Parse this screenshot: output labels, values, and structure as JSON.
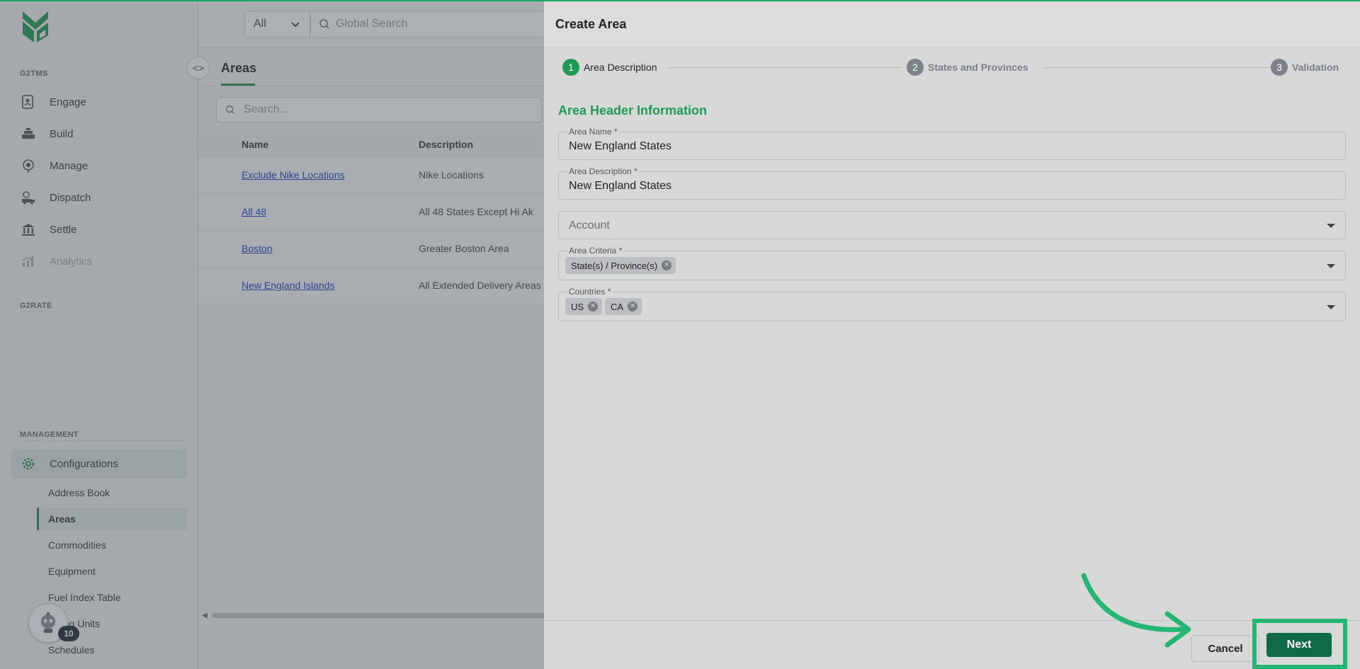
{
  "colors": {
    "brand_green": "#1e9a54",
    "accent_dark_green": "#0f6b45",
    "link_blue": "#1a3fc4",
    "highlight_green": "#26b673"
  },
  "sidebar": {
    "sections": {
      "g2tms": "G2TMS",
      "g2rate": "G2RATE",
      "management": "MANAGEMENT"
    },
    "items": [
      {
        "label": "Engage",
        "icon": "engage-icon"
      },
      {
        "label": "Build",
        "icon": "build-icon"
      },
      {
        "label": "Manage",
        "icon": "manage-icon"
      },
      {
        "label": "Dispatch",
        "icon": "dispatch-icon"
      },
      {
        "label": "Settle",
        "icon": "settle-icon"
      },
      {
        "label": "Analytics",
        "icon": "analytics-icon"
      }
    ],
    "configurations": {
      "label": "Configurations",
      "icon": "gear-icon"
    },
    "sub_items": [
      "Address Book",
      "Areas",
      "Commodities",
      "Equipment",
      "Fuel Index Table",
      "Billing Units",
      "Schedules"
    ],
    "assistant_badge": "10"
  },
  "topbar": {
    "scope": "All",
    "search_placeholder": "Global Search"
  },
  "main": {
    "title": "Areas",
    "search_placeholder": "Search...",
    "columns": [
      "Name",
      "Description"
    ],
    "rows": [
      {
        "name": "Exclude Nike Locations",
        "description": "Nike Locations"
      },
      {
        "name": "All 48",
        "description": "All 48 States Except Hi Ak"
      },
      {
        "name": "Boston",
        "description": "Greater Boston Area"
      },
      {
        "name": "New England Islands",
        "description": "All Extended Delivery Areas"
      }
    ]
  },
  "drawer": {
    "title": "Create Area",
    "steps": [
      {
        "num": "1",
        "label": "Area Description"
      },
      {
        "num": "2",
        "label": "States and Provinces"
      },
      {
        "num": "3",
        "label": "Validation"
      }
    ],
    "section_title": "Area Header Information",
    "fields": {
      "area_name": {
        "label": "Area Name *",
        "value": "New England States"
      },
      "area_description": {
        "label": "Area Description *",
        "value": "New England States"
      },
      "account": {
        "placeholder": "Account"
      },
      "area_criteria": {
        "label": "Area Criteria *",
        "chips": [
          "State(s) / Province(s)"
        ]
      },
      "countries": {
        "label": "Countries *",
        "chips": [
          "US",
          "CA"
        ]
      }
    },
    "cancel_label": "Cancel",
    "next_label": "Next"
  }
}
